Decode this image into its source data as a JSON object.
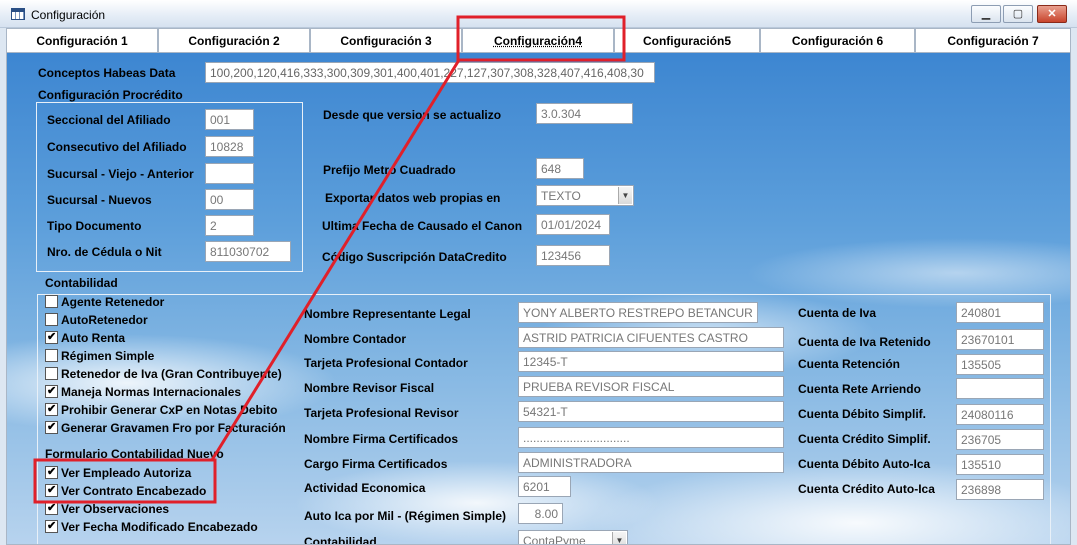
{
  "window": {
    "title": "Configuración"
  },
  "tabs": [
    {
      "label": "Configuración 1"
    },
    {
      "label": "Configuración 2"
    },
    {
      "label": "Configuración 3"
    },
    {
      "label": "Configuración4"
    },
    {
      "label": "Configuración5"
    },
    {
      "label": "Configuración 6"
    },
    {
      "label": "Configuración 7"
    }
  ],
  "habeas": {
    "label": "Conceptos Habeas Data",
    "value": "100,200,120,416,333,300,309,301,400,401,227,127,307,308,328,407,416,408,30"
  },
  "procredito": {
    "title": "Configuración Procrédito",
    "rows": [
      {
        "label": "Seccional del Afiliado",
        "value": "001"
      },
      {
        "label": "Consecutivo del Afiliado",
        "value": "10828"
      },
      {
        "label": "Sucursal - Viejo - Anterior",
        "value": ""
      },
      {
        "label": "Sucursal - Nuevos",
        "value": "00"
      },
      {
        "label": "Tipo Documento",
        "value": "2"
      },
      {
        "label": "Nro. de Cédula o Nit",
        "value": "811030702"
      }
    ]
  },
  "general": {
    "version_label": "Desde que version se actualizo",
    "version_value": "3.0.304",
    "prefijo_label": "Prefijo Metro Cuadrado",
    "prefijo_value": "648",
    "exportar_label": "Exportar datos web propias en",
    "exportar_value": "TEXTO",
    "fecha_label": "Ultima Fecha de Causado el Canon",
    "fecha_value": "01/01/2024",
    "suscripcion_label": "Código Suscripción DataCredito",
    "suscripcion_value": "123456"
  },
  "contabilidad": {
    "title": "Contabilidad",
    "checks": [
      {
        "label": "Agente Retenedor",
        "checked": false
      },
      {
        "label": "AutoRetenedor",
        "checked": false
      },
      {
        "label": "Auto Renta",
        "checked": true
      },
      {
        "label": "Régimen Simple",
        "checked": false
      },
      {
        "label": "Retenedor de Iva (Gran Contribuyente)",
        "checked": false
      },
      {
        "label": "Maneja Normas Internacionales",
        "checked": true
      },
      {
        "label": "Prohibir Generar CxP en Notas Debito",
        "checked": true
      },
      {
        "label": "Generar Gravamen Fro por Facturación",
        "checked": true
      }
    ],
    "formulario_title": "Formulario Contabilidad Nuevo",
    "formulario_checks": [
      {
        "label": "Ver Empleado Autoriza",
        "checked": true
      },
      {
        "label": "Ver Contrato Encabezado",
        "checked": true
      },
      {
        "label": "Ver Observaciones",
        "checked": true
      },
      {
        "label": "Ver Fecha Modificado Encabezado",
        "checked": true
      }
    ],
    "middle": [
      {
        "label": "Nombre Representante Legal",
        "value": "YONY ALBERTO RESTREPO BETANCUR"
      },
      {
        "label": "Nombre Contador",
        "value": "ASTRID PATRICIA CIFUENTES CASTRO"
      },
      {
        "label": "Tarjeta Profesional Contador",
        "value": "12345-T"
      },
      {
        "label": "Nombre Revisor Fiscal",
        "value": "PRUEBA REVISOR FISCAL"
      },
      {
        "label": "Tarjeta Profesional Revisor",
        "value": "54321-T"
      },
      {
        "label": "Nombre Firma Certificados",
        "value": "................................"
      },
      {
        "label": "Cargo Firma Certificados",
        "value": "ADMINISTRADORA"
      },
      {
        "label": "Actividad Economica",
        "value": "6201"
      },
      {
        "label": "Auto Ica por Mil - (Régimen Simple)",
        "value": "8.00"
      },
      {
        "label": "Contabilidad",
        "value": "ContaPyme"
      }
    ],
    "right": [
      {
        "label": "Cuenta de Iva",
        "value": "240801"
      },
      {
        "label": "Cuenta de Iva Retenido",
        "value": "23670101"
      },
      {
        "label": "Cuenta Retención",
        "value": "135505"
      },
      {
        "label": "Cuenta Rete Arriendo",
        "value": ""
      },
      {
        "label": "Cuenta Débito Simplif.",
        "value": "24080116"
      },
      {
        "label": "Cuenta Crédito Simplif.",
        "value": "236705"
      },
      {
        "label": "Cuenta Débito Auto-Ica",
        "value": "135510"
      },
      {
        "label": "Cuenta Crédito  Auto-Ica",
        "value": "236898"
      }
    ]
  },
  "colors": {
    "highlight": "#e0202a",
    "tab_border": "#a9b6c6"
  },
  "icons": [
    "app-table-icon",
    "minimize-icon",
    "maximize-icon",
    "close-icon",
    "chevron-down-icon",
    "check-icon"
  ]
}
